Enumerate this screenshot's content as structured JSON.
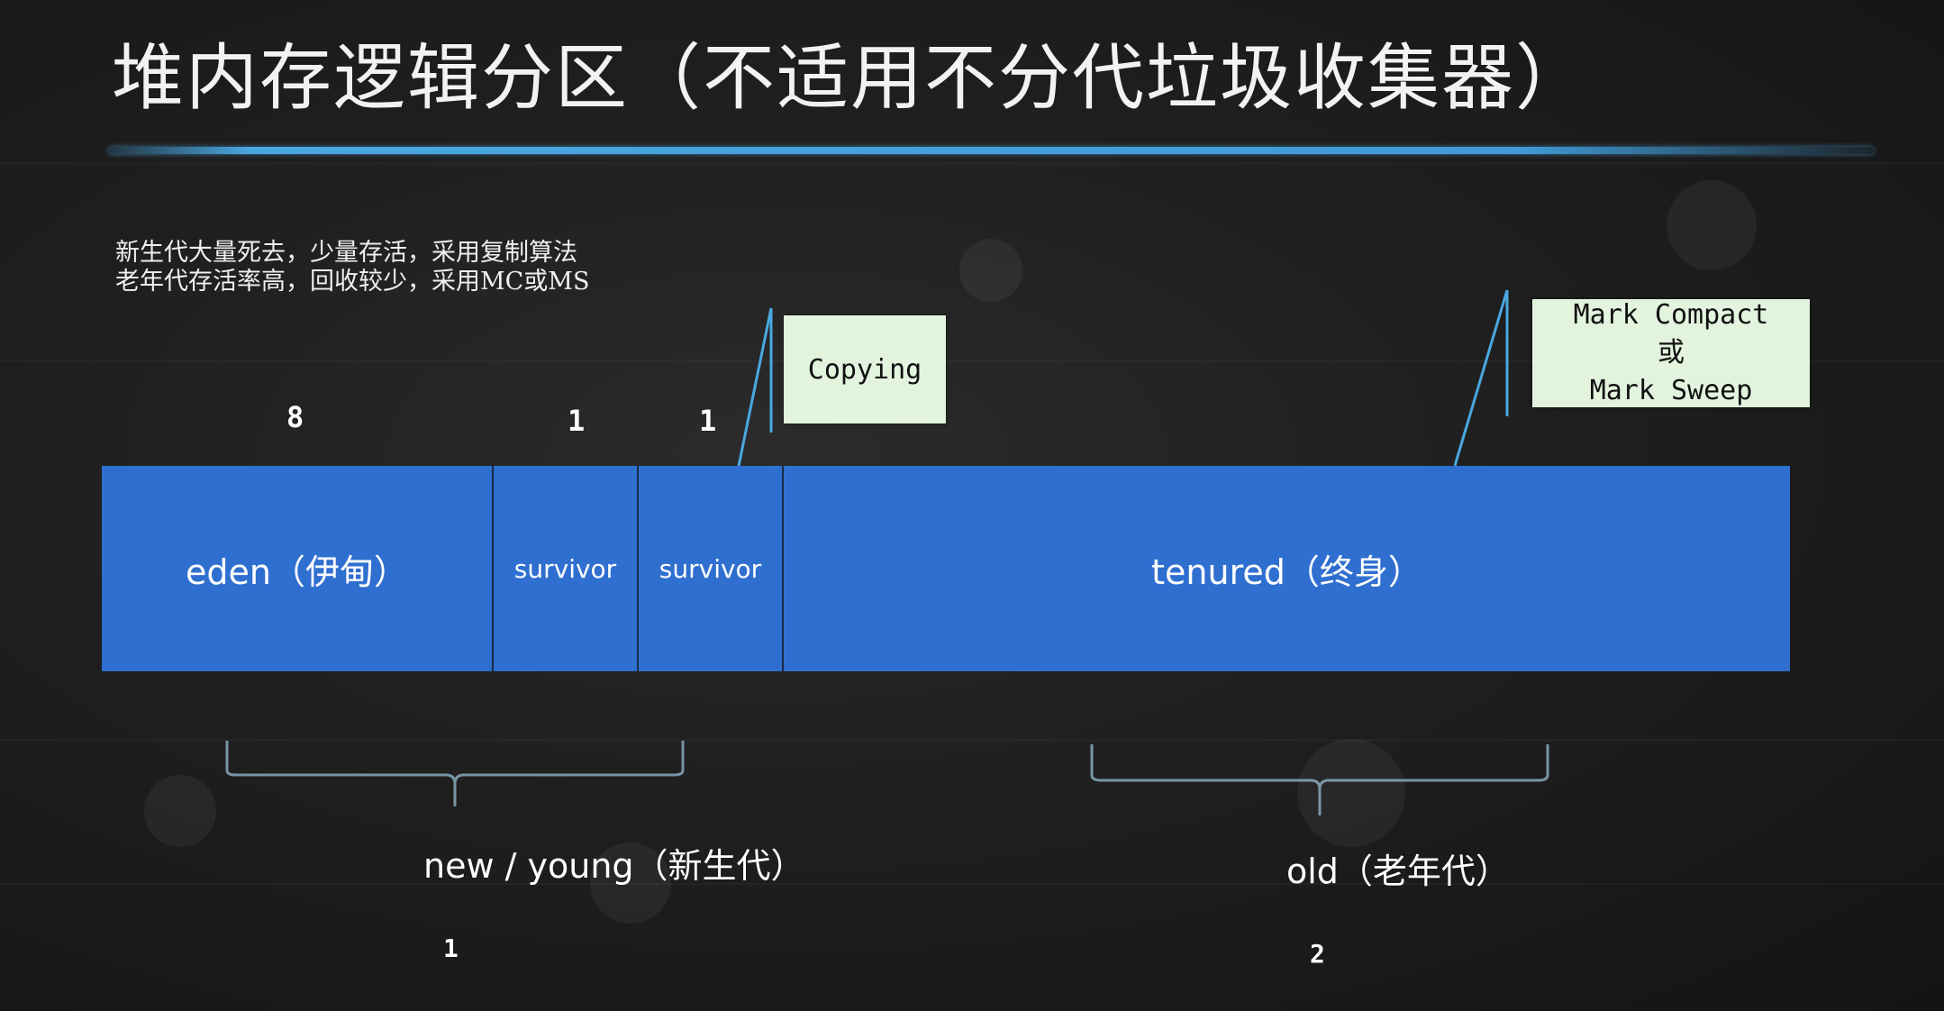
{
  "title": "堆内存逻辑分区（不适用不分代垃圾收集器）",
  "notes": [
    "新生代大量死去，少量存活，采用复制算法",
    "老年代存活率高，回收较少，采用MC或MS"
  ],
  "ratios": {
    "eden": "8",
    "survivor_1": "1",
    "survivor_2": "1"
  },
  "segments": {
    "eden": "eden（伊甸）",
    "survivor_1": "survivor",
    "survivor_2": "survivor",
    "tenured": "tenured（终身）"
  },
  "callouts": {
    "copying": "Copying",
    "mark_compact": "Mark Compact",
    "or": "或",
    "mark_sweep": "Mark Sweep"
  },
  "generations": {
    "young_label": "new / young（新生代）",
    "young_ratio": "1",
    "old_label": "old（老年代）",
    "old_ratio": "2"
  },
  "colors": {
    "heap_blue": "#2f6fd0",
    "callout_bg": "#e2f3de",
    "accent_line": "#4aa8e0",
    "brace": "#8fb3c7"
  }
}
